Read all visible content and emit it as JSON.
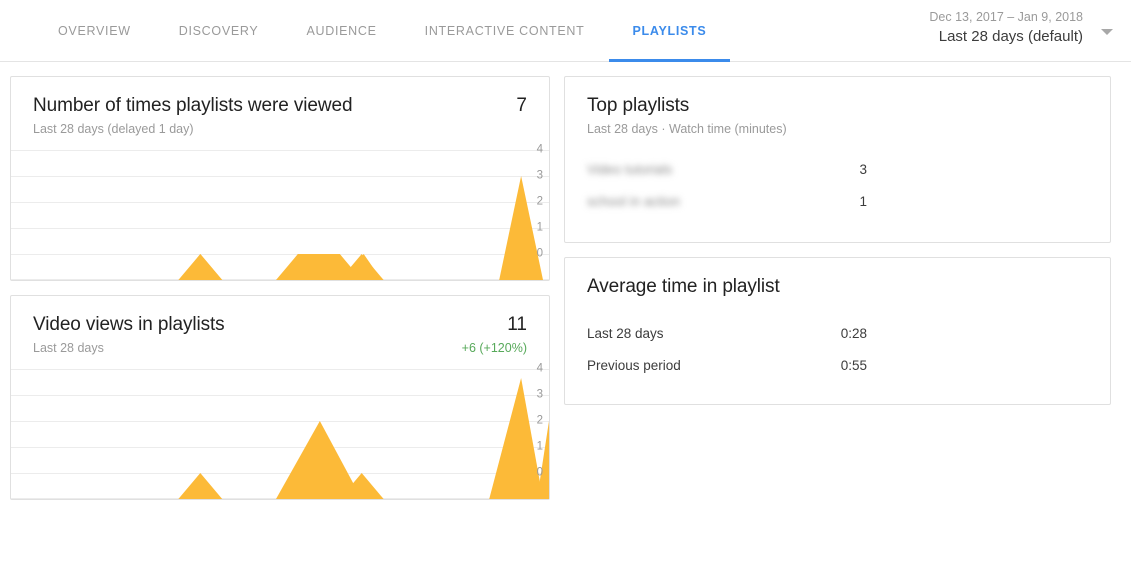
{
  "nav": {
    "tabs": [
      {
        "label": "OVERVIEW",
        "active": false
      },
      {
        "label": "DISCOVERY",
        "active": false
      },
      {
        "label": "AUDIENCE",
        "active": false
      },
      {
        "label": "INTERACTIVE CONTENT",
        "active": false
      },
      {
        "label": "PLAYLISTS",
        "active": true
      }
    ],
    "accent_color": "#3b8beb"
  },
  "date_range": {
    "range": "Dec 13, 2017 – Jan 9, 2018",
    "preset": "Last 28 days (default)",
    "caret_icon": "chevron-down-icon"
  },
  "cards": {
    "playlist_views": {
      "title": "Number of times playlists were viewed",
      "value": "7",
      "subtitle": "Last 28 days (delayed 1 day)"
    },
    "video_views": {
      "title": "Video views in playlists",
      "value": "11",
      "subtitle": "Last 28 days",
      "delta": "+6 (+120%)",
      "delta_color": "#57a95a"
    },
    "top_playlists": {
      "title": "Top playlists",
      "subtitle": "Last 28 days · Watch time (minutes)",
      "rows": [
        {
          "label": "Video tutorials",
          "value": "3",
          "redacted": true
        },
        {
          "label": "school in action",
          "value": "1",
          "redacted": true
        }
      ]
    },
    "average_time": {
      "title": "Average time in playlist",
      "rows": [
        {
          "label": "Last 28 days",
          "value": "0:28",
          "color": "#fcba38"
        },
        {
          "label": "Previous period",
          "value": "0:55",
          "color": "#b5b5b5"
        }
      ]
    }
  },
  "chart_data": [
    {
      "type": "area",
      "title": "Number of times playlists were viewed",
      "subtitle": "Last 28 days (delayed 1 day)",
      "total": 7,
      "xlabel": "",
      "ylabel": "",
      "ylim": [
        0,
        4
      ],
      "yticks": [
        4,
        3,
        2,
        1,
        0
      ],
      "grid": true,
      "fill_color": "#fcba38",
      "x": [
        1,
        2,
        3,
        4,
        5,
        6,
        7,
        8,
        9,
        10,
        11,
        12,
        13,
        14,
        15,
        16,
        17,
        18,
        19,
        20,
        21,
        22,
        23,
        24,
        25,
        26,
        27,
        28
      ],
      "values": [
        0,
        0,
        0,
        0,
        0,
        0,
        0,
        0,
        0,
        1,
        0,
        0,
        0,
        0,
        1,
        1,
        0,
        1,
        0,
        0,
        0,
        0,
        0,
        0,
        0,
        0,
        2.7,
        0
      ]
    },
    {
      "type": "area",
      "title": "Video views in playlists",
      "subtitle": "Last 28 days",
      "total": 11,
      "delta": "+6 (+120%)",
      "xlabel": "",
      "ylabel": "",
      "ylim": [
        0,
        4
      ],
      "yticks": [
        4,
        3,
        2,
        1,
        0
      ],
      "grid": true,
      "fill_color": "#fcba38",
      "x": [
        1,
        2,
        3,
        4,
        5,
        6,
        7,
        8,
        9,
        10,
        11,
        12,
        13,
        14,
        15,
        16,
        17,
        18,
        19,
        20,
        21,
        22,
        23,
        24,
        25,
        26,
        27,
        28
      ],
      "values": [
        0,
        0,
        0,
        0,
        0,
        0,
        0,
        0,
        0,
        1,
        0,
        0,
        0,
        0,
        2,
        0,
        0,
        1,
        0,
        0,
        0,
        0,
        0,
        0,
        0,
        0,
        3.8,
        0,
        2
      ]
    },
    {
      "type": "bar",
      "orientation": "horizontal",
      "title": "Top playlists",
      "subtitle": "Last 28 days · Watch time (minutes)",
      "categories": [
        "Video tutorials",
        "school in action"
      ],
      "values": [
        3,
        1
      ],
      "max": 3,
      "fill_color": "#fcba38"
    },
    {
      "type": "bar",
      "orientation": "horizontal",
      "title": "Average time in playlist",
      "categories": [
        "Last 28 days",
        "Previous period"
      ],
      "values": [
        28,
        55
      ],
      "value_labels": [
        "0:28",
        "0:55"
      ],
      "max": 55,
      "colors": [
        "#fcba38",
        "#b5b5b5"
      ]
    }
  ]
}
